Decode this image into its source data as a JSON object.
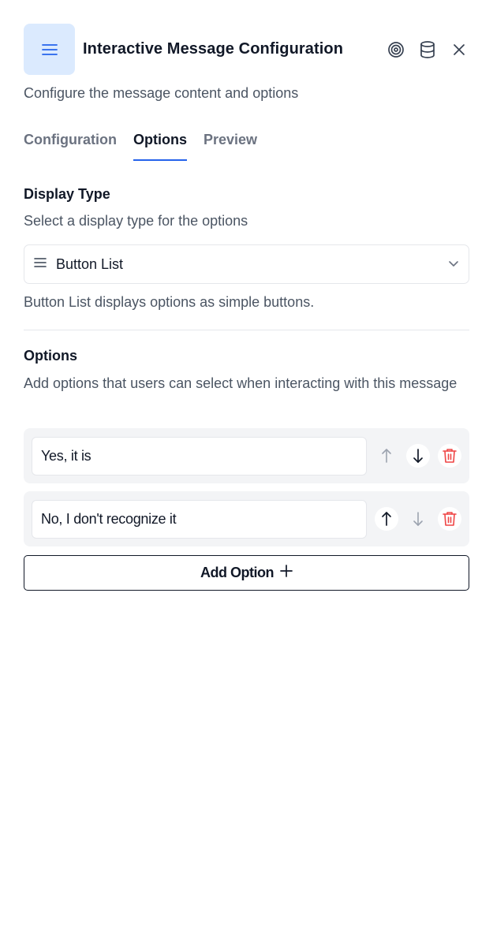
{
  "header": {
    "title": "Interactive Message Configuration",
    "subtitle": "Configure the message content and options",
    "icons": {
      "node": "list-icon",
      "target": "target-icon",
      "database": "database-icon",
      "close": "close-icon"
    }
  },
  "tabs": [
    {
      "label": "Configuration",
      "active": false
    },
    {
      "label": "Options",
      "active": true
    },
    {
      "label": "Preview",
      "active": false
    }
  ],
  "display_type": {
    "title": "Display Type",
    "description": "Select a display type for the options",
    "selected": "Button List",
    "helper": "Button List displays options as simple buttons."
  },
  "options_section": {
    "title": "Options",
    "description": "Add options that users can select when interacting with this message",
    "items": [
      {
        "value": "Yes, it is",
        "can_move_up": false,
        "can_move_down": true
      },
      {
        "value": "No, I don't recognize it",
        "can_move_up": true,
        "can_move_down": false
      }
    ],
    "add_label": "Add Option"
  },
  "colors": {
    "accent": "#2563eb",
    "accent_bg": "#dbeafe",
    "danger": "#ef4444",
    "muted": "#6b7280",
    "row_bg": "#f3f4f6"
  }
}
